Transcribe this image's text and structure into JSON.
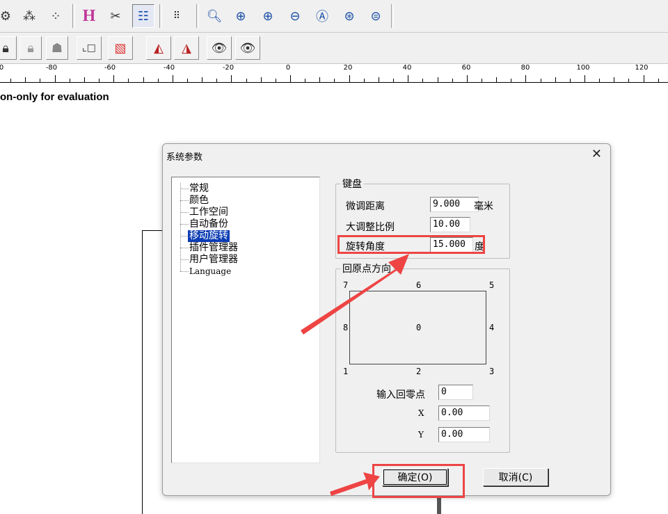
{
  "toolbar1": {
    "icons": [
      "node-icon",
      "nodes-icon",
      "nodes-alt-icon",
      "h-layout-icon",
      "tools-icon",
      "properties-icon",
      "grid-icon",
      "zoom-icon",
      "zoom-move-icon",
      "zoom-in-icon",
      "zoom-out-icon",
      "zoom-fit-icon",
      "zoom-all-icon",
      "zoom-page-icon"
    ]
  },
  "toolbar2": {
    "icons": [
      "lock-icon",
      "lock-gray-icon",
      "unlock-icon",
      "origin-icon",
      "layer-color-icon",
      "mirror-horizontal-icon",
      "mirror-vertical-icon",
      "eye-icon",
      "eye-alt-icon"
    ]
  },
  "ruler": {
    "labels": [
      "0",
      "-80",
      "-60",
      "-40",
      "-20",
      "0",
      "20",
      "40",
      "60",
      "80",
      "100",
      "120"
    ]
  },
  "watermark": "on-only for evaluation",
  "dialog": {
    "title": "系统参数",
    "close": "✕",
    "tree": [
      "常规",
      "颜色",
      "工作空间",
      "自动备份",
      "移动旋转",
      "插件管理器",
      "用户管理器",
      "Language"
    ],
    "tree_selected": "移动旋转",
    "keyboard": {
      "legend": "键盘",
      "fine_label": "微调距离",
      "fine_value": "9.000",
      "fine_unit": "毫米",
      "coarse_label": "大调整比例",
      "coarse_value": "10.00",
      "rotate_label": "旋转角度",
      "rotate_value": "15.000",
      "rotate_unit": "度"
    },
    "origin": {
      "legend": "回原点方向",
      "numbers": {
        "n0": "0",
        "n1": "1",
        "n2": "2",
        "n3": "3",
        "n4": "4",
        "n5": "5",
        "n6": "6",
        "n7": "7",
        "n8": "8"
      },
      "input_label": "输入回零点",
      "input_value": "0",
      "x_label": "X",
      "x_value": "0.00",
      "y_label": "Y",
      "y_value": "0.00"
    },
    "ok_button": "确定(O)",
    "cancel_button": "取消(C)"
  },
  "colors": {
    "highlight": "#ee4444",
    "selection": "#0a3cb4"
  }
}
